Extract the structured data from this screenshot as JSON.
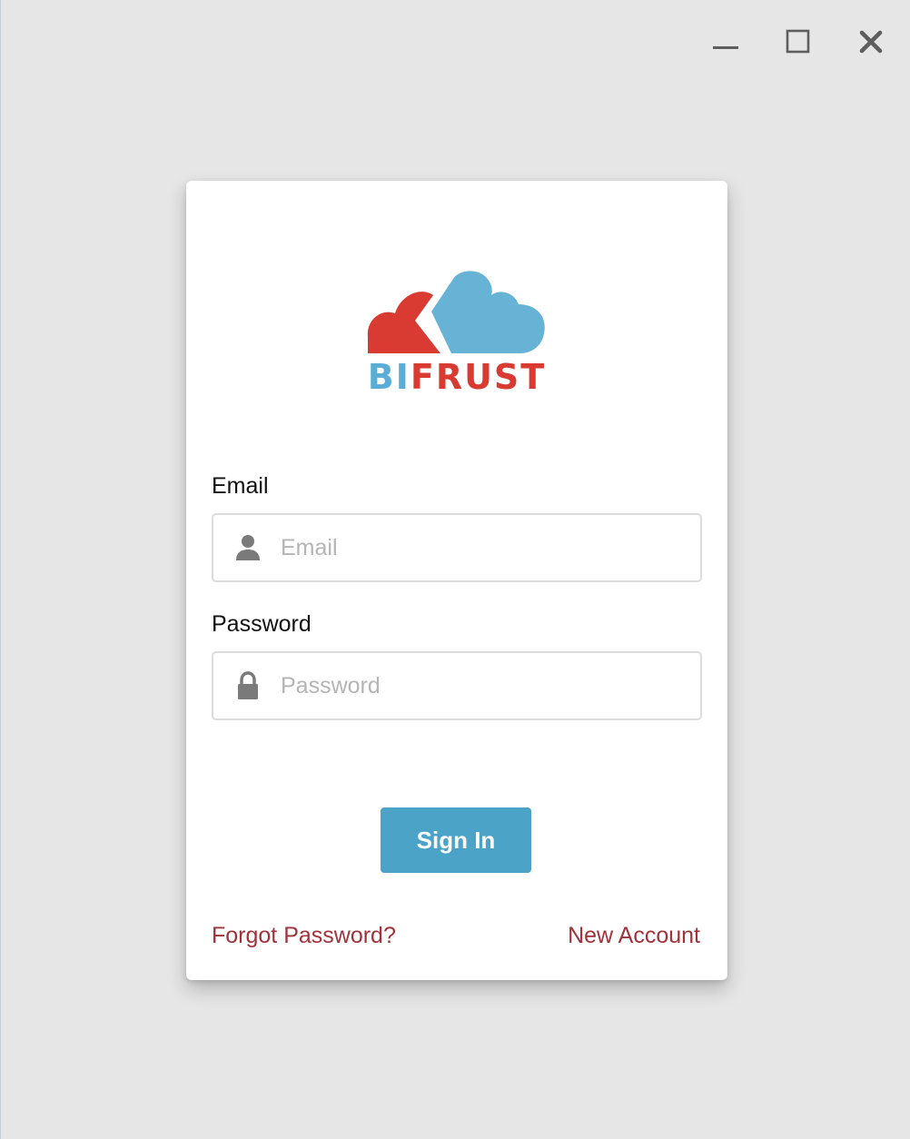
{
  "window_controls": {
    "minimize": "minimize",
    "maximize": "maximize",
    "close": "close"
  },
  "logo": {
    "text_part1": "BI",
    "text_part2": "FRUST",
    "colors": {
      "blue": "#67b3d6",
      "red": "#d93a32"
    }
  },
  "form": {
    "email_label": "Email",
    "email_placeholder": "Email",
    "email_value": "",
    "email_icon": "user-icon",
    "password_label": "Password",
    "password_placeholder": "Password",
    "password_value": "",
    "password_icon": "lock-icon"
  },
  "actions": {
    "sign_in": "Sign In",
    "forgot_password": "Forgot Password?",
    "new_account": "New Account"
  },
  "colors": {
    "background": "#e6e6e6",
    "card": "#ffffff",
    "primary_button": "#4ba3c8",
    "link": "#a0323a"
  }
}
